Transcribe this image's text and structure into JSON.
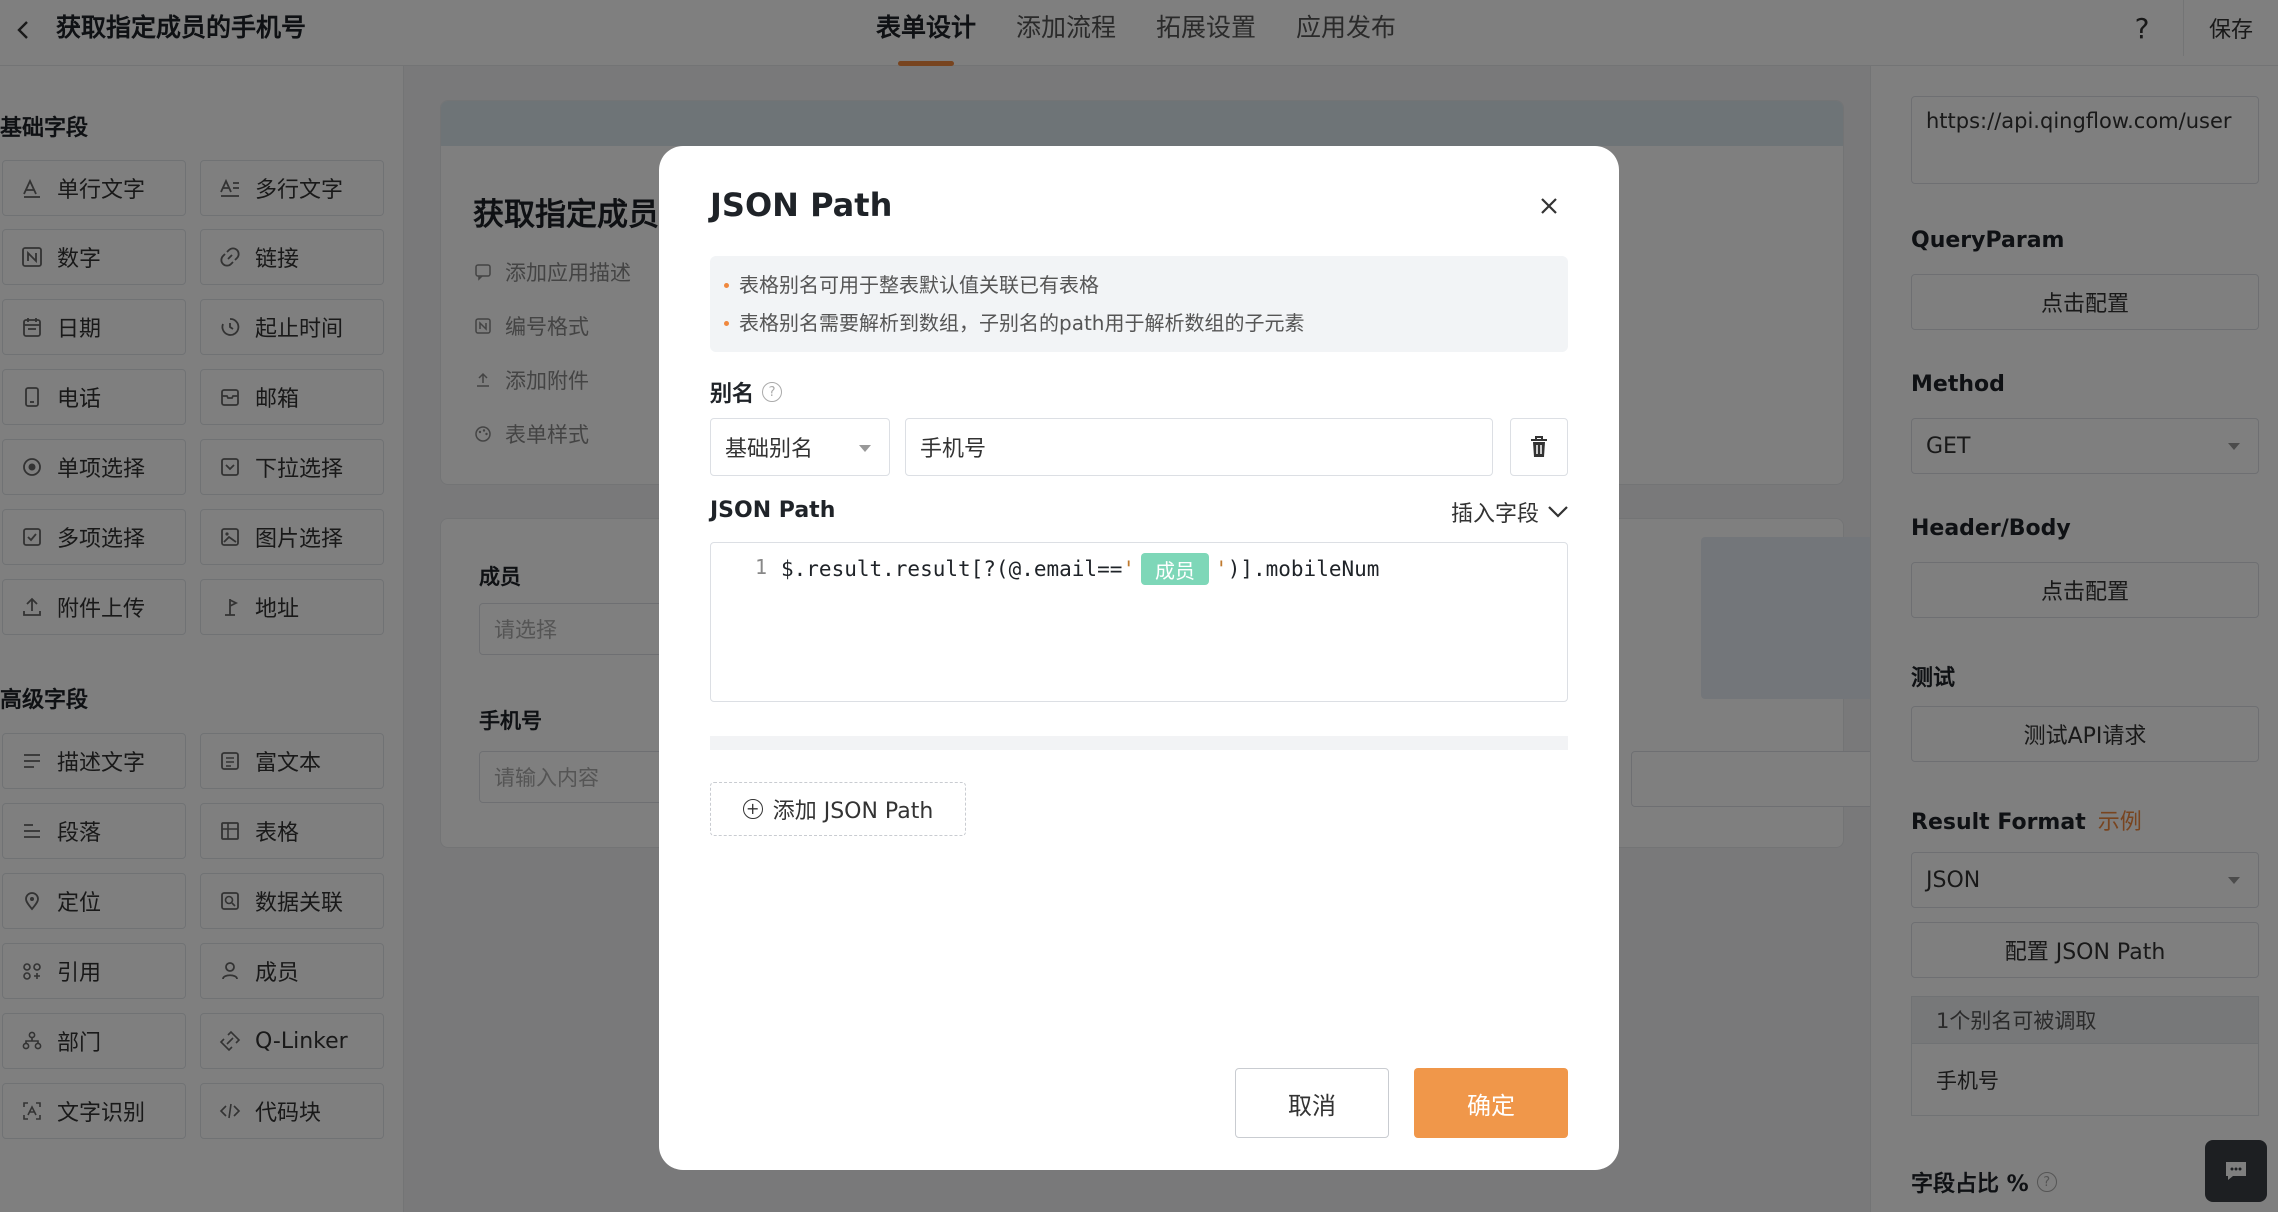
{
  "header": {
    "title": "获取指定成员的手机号",
    "tabs": [
      "表单设计",
      "添加流程",
      "拓展设置",
      "应用发布"
    ],
    "help_label": "?",
    "save_label": "保存"
  },
  "sidebar": {
    "basic_title": "基础字段",
    "basic_fields": [
      {
        "label": "单行文字",
        "icon": "text-line-icon"
      },
      {
        "label": "多行文字",
        "icon": "text-multi-icon"
      },
      {
        "label": "数字",
        "icon": "number-icon"
      },
      {
        "label": "链接",
        "icon": "link-icon"
      },
      {
        "label": "日期",
        "icon": "calendar-icon"
      },
      {
        "label": "起止时间",
        "icon": "time-range-icon"
      },
      {
        "label": "电话",
        "icon": "phone-icon"
      },
      {
        "label": "邮箱",
        "icon": "mail-icon"
      },
      {
        "label": "单项选择",
        "icon": "radio-icon"
      },
      {
        "label": "下拉选择",
        "icon": "dropdown-icon"
      },
      {
        "label": "多项选择",
        "icon": "checkbox-icon"
      },
      {
        "label": "图片选择",
        "icon": "image-icon"
      },
      {
        "label": "附件上传",
        "icon": "upload-icon"
      },
      {
        "label": "地址",
        "icon": "location-pin-icon"
      }
    ],
    "advanced_title": "高级字段",
    "advanced_fields": [
      {
        "label": "描述文字",
        "icon": "description-icon"
      },
      {
        "label": "富文本",
        "icon": "rich-text-icon"
      },
      {
        "label": "段落",
        "icon": "paragraph-icon"
      },
      {
        "label": "表格",
        "icon": "table-icon"
      },
      {
        "label": "定位",
        "icon": "map-pin-icon"
      },
      {
        "label": "数据关联",
        "icon": "data-link-icon"
      },
      {
        "label": "引用",
        "icon": "reference-icon"
      },
      {
        "label": "成员",
        "icon": "user-icon"
      },
      {
        "label": "部门",
        "icon": "org-icon"
      },
      {
        "label": "Q-Linker",
        "icon": "q-linker-icon"
      },
      {
        "label": "文字识别",
        "icon": "ocr-icon"
      },
      {
        "label": "代码块",
        "icon": "code-icon"
      }
    ]
  },
  "form": {
    "title": "获取指定成员",
    "options": [
      "添加应用描述",
      "编号格式",
      "添加附件",
      "表单样式"
    ],
    "field1_label": "成员",
    "field1_placeholder": "请选择",
    "field2_label": "手机号",
    "field2_placeholder": "请输入内容"
  },
  "right_panel": {
    "url_value": "https://api.qingflow.com/user",
    "query_label": "QueryParam",
    "config_label": "点击配置",
    "method_label": "Method",
    "method_value": "GET",
    "header_label": "Header/Body",
    "test_label": "测试",
    "test_button": "测试API请求",
    "result_label": "Result Format",
    "example_label": "示例",
    "result_value": "JSON",
    "config_json_path": "配置 JSON Path",
    "alias_count": "1个别名可被调取",
    "alias_item": "手机号",
    "ratio_label": "字段占比 %"
  },
  "modal": {
    "title": "JSON Path",
    "tips": [
      "表格别名可用于整表默认值关联已有表格",
      "表格别名需要解析到数组，子别名的path用于解析数组的子元素"
    ],
    "alias_label": "别名",
    "alias_type": "基础别名",
    "alias_value": "手机号",
    "json_path_label": "JSON Path",
    "insert_field": "插入字段",
    "code": {
      "line_no": "1",
      "prefix": "$.result.result[?(@.email==",
      "quote_open": "'",
      "tag": "成员",
      "quote_close": "'",
      "suffix": ")].mobileNum"
    },
    "add_json_path": "添加 JSON Path",
    "cancel": "取消",
    "ok": "确定"
  },
  "colors": {
    "accent": "#f0883e",
    "tag_bg": "#7ed7b8",
    "ok_bg": "#f0974a"
  }
}
